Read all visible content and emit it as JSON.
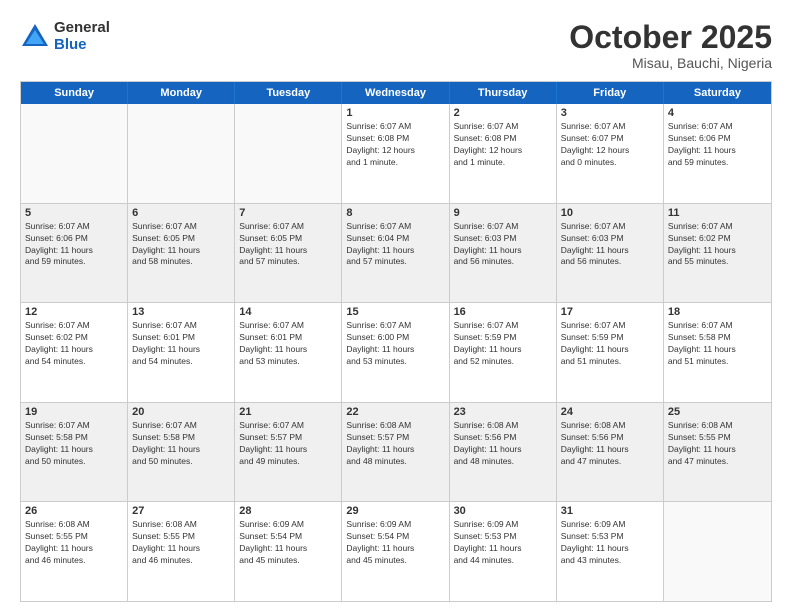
{
  "header": {
    "logo": {
      "line1": "General",
      "line2": "Blue"
    },
    "title": "October 2025",
    "location": "Misau, Bauchi, Nigeria"
  },
  "days_of_week": [
    "Sunday",
    "Monday",
    "Tuesday",
    "Wednesday",
    "Thursday",
    "Friday",
    "Saturday"
  ],
  "weeks": [
    {
      "cells": [
        {
          "empty": true,
          "text": ""
        },
        {
          "empty": true,
          "text": ""
        },
        {
          "empty": true,
          "text": ""
        },
        {
          "day": "1",
          "lines": [
            "Sunrise: 6:07 AM",
            "Sunset: 6:08 PM",
            "Daylight: 12 hours",
            "and 1 minute."
          ]
        },
        {
          "day": "2",
          "lines": [
            "Sunrise: 6:07 AM",
            "Sunset: 6:08 PM",
            "Daylight: 12 hours",
            "and 1 minute."
          ]
        },
        {
          "day": "3",
          "lines": [
            "Sunrise: 6:07 AM",
            "Sunset: 6:07 PM",
            "Daylight: 12 hours",
            "and 0 minutes."
          ]
        },
        {
          "day": "4",
          "lines": [
            "Sunrise: 6:07 AM",
            "Sunset: 6:06 PM",
            "Daylight: 11 hours",
            "and 59 minutes."
          ]
        }
      ]
    },
    {
      "cells": [
        {
          "day": "5",
          "lines": [
            "Sunrise: 6:07 AM",
            "Sunset: 6:06 PM",
            "Daylight: 11 hours",
            "and 59 minutes."
          ]
        },
        {
          "day": "6",
          "lines": [
            "Sunrise: 6:07 AM",
            "Sunset: 6:05 PM",
            "Daylight: 11 hours",
            "and 58 minutes."
          ]
        },
        {
          "day": "7",
          "lines": [
            "Sunrise: 6:07 AM",
            "Sunset: 6:05 PM",
            "Daylight: 11 hours",
            "and 57 minutes."
          ]
        },
        {
          "day": "8",
          "lines": [
            "Sunrise: 6:07 AM",
            "Sunset: 6:04 PM",
            "Daylight: 11 hours",
            "and 57 minutes."
          ]
        },
        {
          "day": "9",
          "lines": [
            "Sunrise: 6:07 AM",
            "Sunset: 6:03 PM",
            "Daylight: 11 hours",
            "and 56 minutes."
          ]
        },
        {
          "day": "10",
          "lines": [
            "Sunrise: 6:07 AM",
            "Sunset: 6:03 PM",
            "Daylight: 11 hours",
            "and 56 minutes."
          ]
        },
        {
          "day": "11",
          "lines": [
            "Sunrise: 6:07 AM",
            "Sunset: 6:02 PM",
            "Daylight: 11 hours",
            "and 55 minutes."
          ]
        }
      ]
    },
    {
      "cells": [
        {
          "day": "12",
          "lines": [
            "Sunrise: 6:07 AM",
            "Sunset: 6:02 PM",
            "Daylight: 11 hours",
            "and 54 minutes."
          ]
        },
        {
          "day": "13",
          "lines": [
            "Sunrise: 6:07 AM",
            "Sunset: 6:01 PM",
            "Daylight: 11 hours",
            "and 54 minutes."
          ]
        },
        {
          "day": "14",
          "lines": [
            "Sunrise: 6:07 AM",
            "Sunset: 6:01 PM",
            "Daylight: 11 hours",
            "and 53 minutes."
          ]
        },
        {
          "day": "15",
          "lines": [
            "Sunrise: 6:07 AM",
            "Sunset: 6:00 PM",
            "Daylight: 11 hours",
            "and 53 minutes."
          ]
        },
        {
          "day": "16",
          "lines": [
            "Sunrise: 6:07 AM",
            "Sunset: 5:59 PM",
            "Daylight: 11 hours",
            "and 52 minutes."
          ]
        },
        {
          "day": "17",
          "lines": [
            "Sunrise: 6:07 AM",
            "Sunset: 5:59 PM",
            "Daylight: 11 hours",
            "and 51 minutes."
          ]
        },
        {
          "day": "18",
          "lines": [
            "Sunrise: 6:07 AM",
            "Sunset: 5:58 PM",
            "Daylight: 11 hours",
            "and 51 minutes."
          ]
        }
      ]
    },
    {
      "cells": [
        {
          "day": "19",
          "lines": [
            "Sunrise: 6:07 AM",
            "Sunset: 5:58 PM",
            "Daylight: 11 hours",
            "and 50 minutes."
          ]
        },
        {
          "day": "20",
          "lines": [
            "Sunrise: 6:07 AM",
            "Sunset: 5:58 PM",
            "Daylight: 11 hours",
            "and 50 minutes."
          ]
        },
        {
          "day": "21",
          "lines": [
            "Sunrise: 6:07 AM",
            "Sunset: 5:57 PM",
            "Daylight: 11 hours",
            "and 49 minutes."
          ]
        },
        {
          "day": "22",
          "lines": [
            "Sunrise: 6:08 AM",
            "Sunset: 5:57 PM",
            "Daylight: 11 hours",
            "and 48 minutes."
          ]
        },
        {
          "day": "23",
          "lines": [
            "Sunrise: 6:08 AM",
            "Sunset: 5:56 PM",
            "Daylight: 11 hours",
            "and 48 minutes."
          ]
        },
        {
          "day": "24",
          "lines": [
            "Sunrise: 6:08 AM",
            "Sunset: 5:56 PM",
            "Daylight: 11 hours",
            "and 47 minutes."
          ]
        },
        {
          "day": "25",
          "lines": [
            "Sunrise: 6:08 AM",
            "Sunset: 5:55 PM",
            "Daylight: 11 hours",
            "and 47 minutes."
          ]
        }
      ]
    },
    {
      "cells": [
        {
          "day": "26",
          "lines": [
            "Sunrise: 6:08 AM",
            "Sunset: 5:55 PM",
            "Daylight: 11 hours",
            "and 46 minutes."
          ]
        },
        {
          "day": "27",
          "lines": [
            "Sunrise: 6:08 AM",
            "Sunset: 5:55 PM",
            "Daylight: 11 hours",
            "and 46 minutes."
          ]
        },
        {
          "day": "28",
          "lines": [
            "Sunrise: 6:09 AM",
            "Sunset: 5:54 PM",
            "Daylight: 11 hours",
            "and 45 minutes."
          ]
        },
        {
          "day": "29",
          "lines": [
            "Sunrise: 6:09 AM",
            "Sunset: 5:54 PM",
            "Daylight: 11 hours",
            "and 45 minutes."
          ]
        },
        {
          "day": "30",
          "lines": [
            "Sunrise: 6:09 AM",
            "Sunset: 5:53 PM",
            "Daylight: 11 hours",
            "and 44 minutes."
          ]
        },
        {
          "day": "31",
          "lines": [
            "Sunrise: 6:09 AM",
            "Sunset: 5:53 PM",
            "Daylight: 11 hours",
            "and 43 minutes."
          ]
        },
        {
          "empty": true,
          "text": ""
        }
      ]
    }
  ]
}
